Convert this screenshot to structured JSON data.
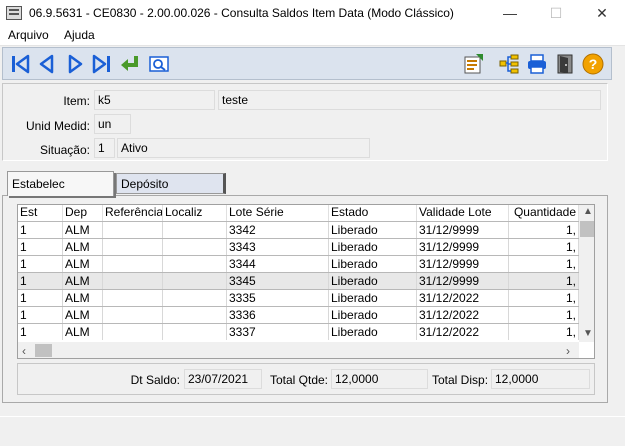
{
  "window": {
    "title": "06.9.5631 - CE0830 - 2.00.00.026 - Consulta Saldos Item Data (Modo Clássico)",
    "minimize": "—",
    "maximize": "☐",
    "close": "✕"
  },
  "menu": {
    "arquivo": "Arquivo",
    "ajuda": "Ajuda"
  },
  "colors": {
    "toolbar_bg": "#dbe3ee",
    "nav_blue": "#1a5fd6",
    "return_green": "#4a9a2a",
    "help_orange": "#f2a200"
  },
  "fields": {
    "item_label": "Item:",
    "item_code": "k5",
    "item_desc": "teste",
    "unid_label": "Unid Medid:",
    "unid_value": "un",
    "situacao_label": "Situação:",
    "situacao_code": "1",
    "situacao_desc": "Ativo"
  },
  "tabs": {
    "estabelec": "Estabelec",
    "deposito": "Depósito"
  },
  "grid": {
    "headers": [
      "Est",
      "Dep",
      "Referência",
      "Localiz",
      "Lote Série",
      "Estado",
      "Validade Lote",
      "Quantidade"
    ],
    "rows": [
      [
        "1",
        "ALM",
        "",
        "",
        "3342",
        "Liberado",
        "31/12/9999",
        "1,"
      ],
      [
        "1",
        "ALM",
        "",
        "",
        "3343",
        "Liberado",
        "31/12/9999",
        "1,"
      ],
      [
        "1",
        "ALM",
        "",
        "",
        "3344",
        "Liberado",
        "31/12/9999",
        "1,"
      ],
      [
        "1",
        "ALM",
        "",
        "",
        "3345",
        "Liberado",
        "31/12/9999",
        "1,"
      ],
      [
        "1",
        "ALM",
        "",
        "",
        "3335",
        "Liberado",
        "31/12/2022",
        "1,"
      ],
      [
        "1",
        "ALM",
        "",
        "",
        "3336",
        "Liberado",
        "31/12/2022",
        "1,"
      ],
      [
        "1",
        "ALM",
        "",
        "",
        "3337",
        "Liberado",
        "31/12/2022",
        "1,"
      ]
    ],
    "selected_row": 3
  },
  "totals": {
    "dt_saldo_label": "Dt Saldo:",
    "dt_saldo": "23/07/2021",
    "total_qtde_label": "Total Qtde:",
    "total_qtde": "12,0000",
    "total_disp_label": "Total Disp:",
    "total_disp": "12,0000"
  }
}
